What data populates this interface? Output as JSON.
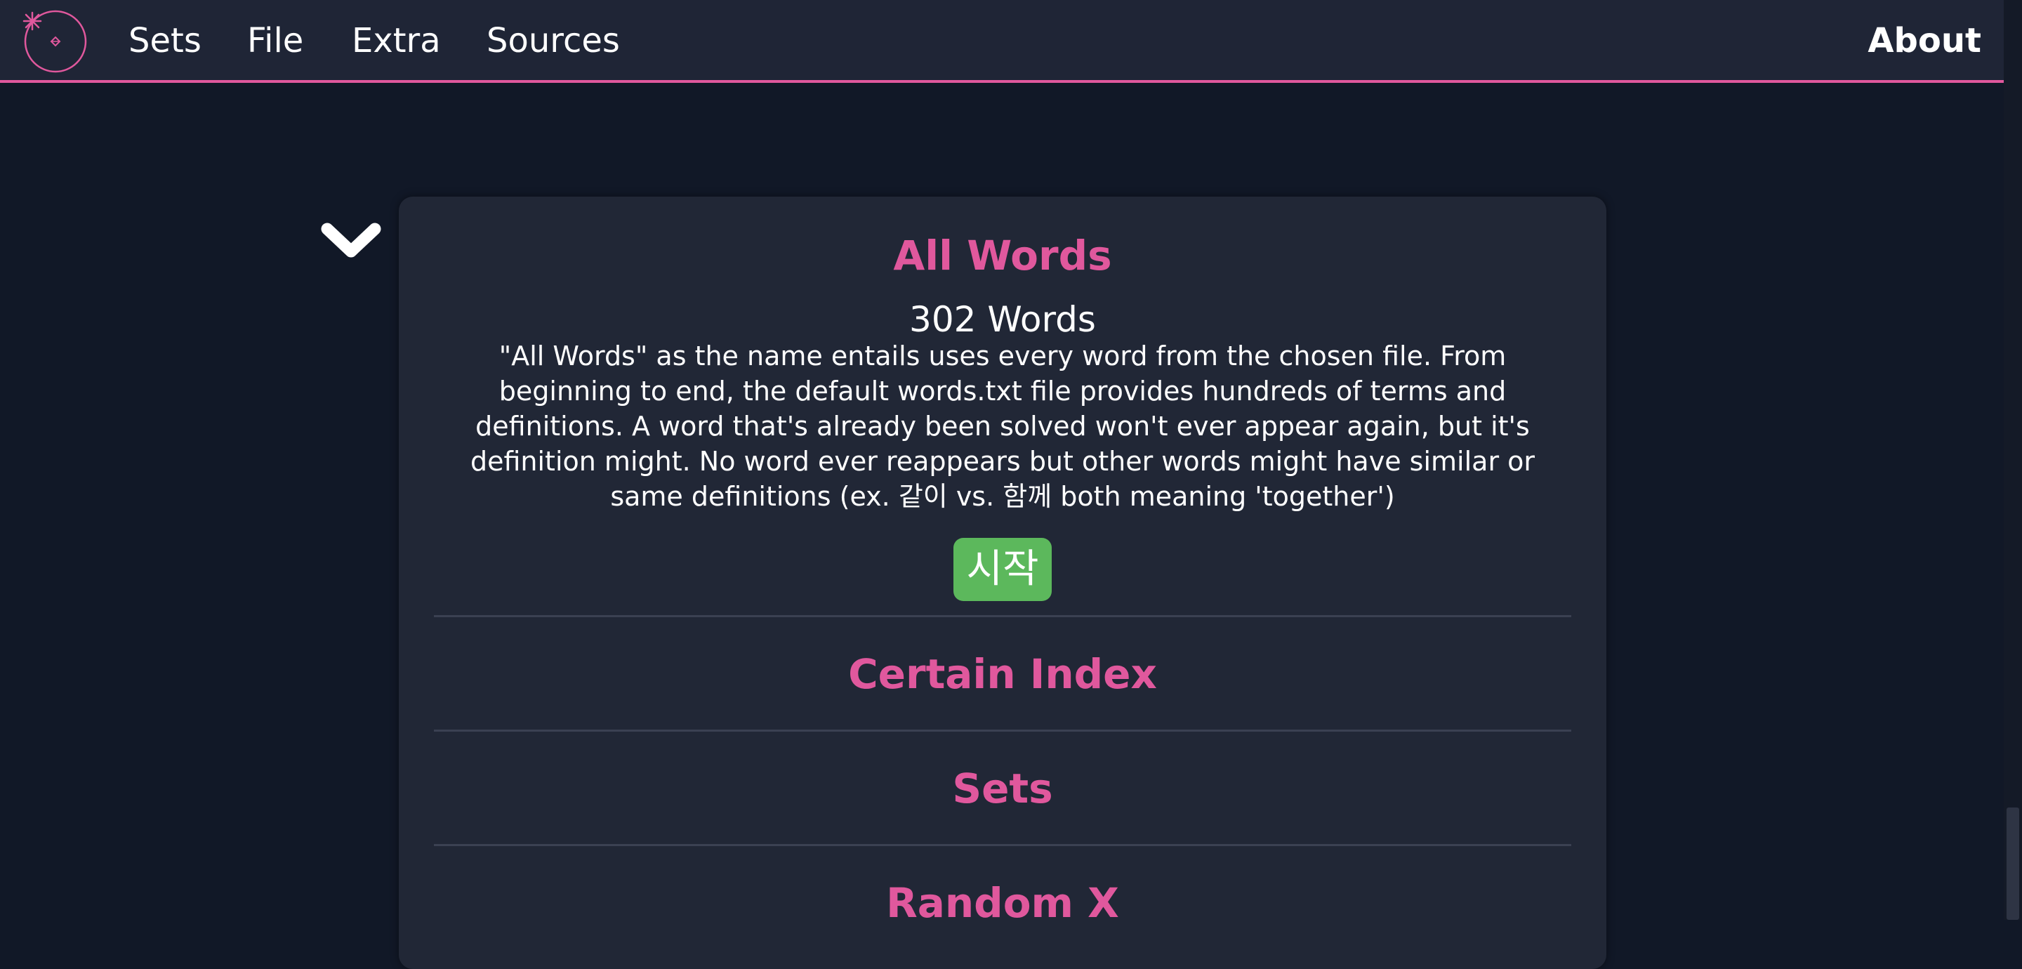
{
  "nav": {
    "items": [
      {
        "label": "Sets"
      },
      {
        "label": "File"
      },
      {
        "label": "Extra"
      },
      {
        "label": "Sources"
      }
    ],
    "about": "About",
    "logo_icon": "compass-logo-icon"
  },
  "colors": {
    "accent": "#e0589d",
    "background": "#111827",
    "navbar": "#1f2536",
    "card": "#212736",
    "start_button": "#5cb85c"
  },
  "toggle_icon": "chevron-down-icon",
  "sections": {
    "all_words": {
      "title": "All Words",
      "count": "302 Words",
      "description": "\"All Words\" as the name entails uses every word from the chosen file. From beginning to end, the default words.txt file provides hundreds of terms and definitions. A word that's already been solved won't ever appear again, but it's definition might. No word ever reappears but other words might have similar or same definitions (ex. 같이 vs. 함께 both meaning 'together')",
      "start_label": "시작"
    },
    "certain_index": {
      "title": "Certain Index"
    },
    "sets": {
      "title": "Sets"
    },
    "random_x": {
      "title": "Random X"
    }
  }
}
